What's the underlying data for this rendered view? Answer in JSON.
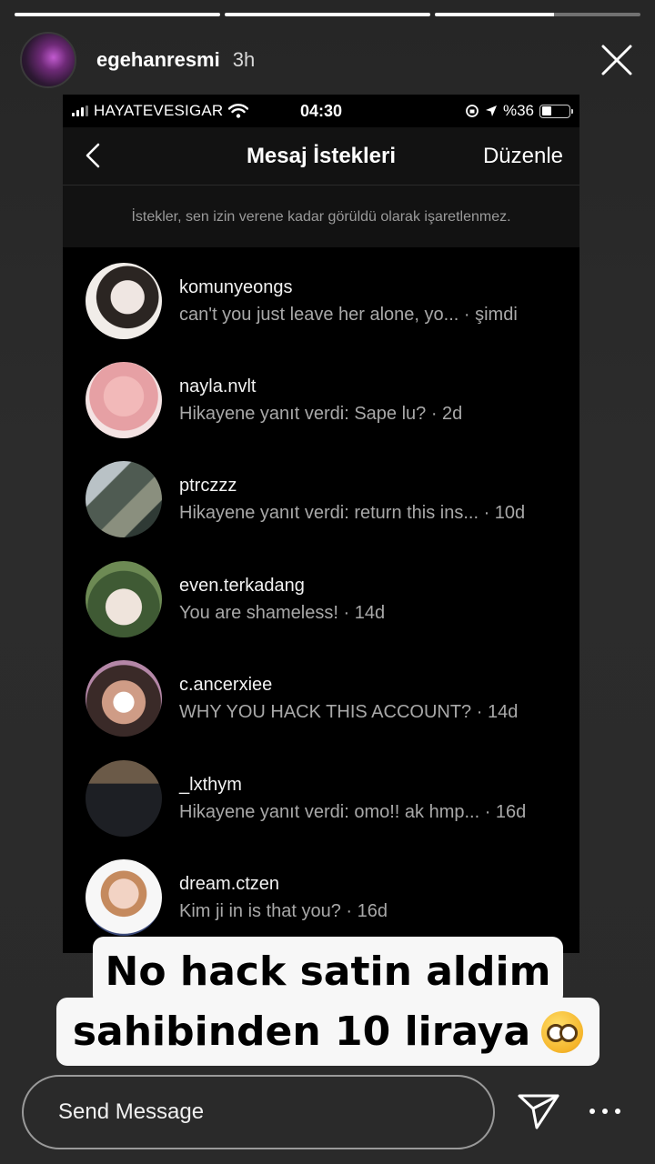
{
  "story": {
    "progress": [
      1.0,
      1.0,
      0.58
    ],
    "username": "egehanresmi",
    "time": "3h",
    "close_icon": "close-icon"
  },
  "screenshot": {
    "status": {
      "carrier": "HAYATEVESIGAR",
      "time": "04:30",
      "battery": "%36",
      "battery_level": 0.36
    },
    "nav": {
      "title": "Mesaj İstekleri",
      "edit": "Düzenle"
    },
    "notice": "İstekler, sen izin verene kadar görüldü olarak işaretlenmez.",
    "requests": [
      {
        "username": "komunyeongs",
        "preview": "can't you just leave her alone, yo...  · şimdi"
      },
      {
        "username": "nayla.nvlt",
        "preview": "Hikayene yanıt verdi: Sape lu? · 2d"
      },
      {
        "username": "ptrczzz",
        "preview": "Hikayene yanıt verdi: return this ins... · 10d"
      },
      {
        "username": "even.terkadang",
        "preview": "You are shameless! · 14d"
      },
      {
        "username": "c.ancerxiee",
        "preview": "WHY YOU HACK THIS ACCOUNT? · 14d"
      },
      {
        "username": "_lxthym",
        "preview": "Hikayene yanıt verdi: omo!! ak hmp... · 16d"
      },
      {
        "username": "dream.ctzen",
        "preview": "Kim ji in is that you? · 16d"
      }
    ]
  },
  "caption": {
    "line1": "No hack satin aldim",
    "line2": "sahibinden 10 liraya"
  },
  "reply": {
    "placeholder": "Send Message"
  }
}
